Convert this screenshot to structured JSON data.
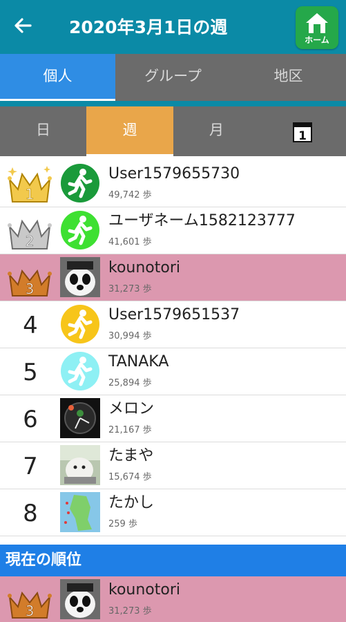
{
  "header": {
    "title": "2020年3月1日の週",
    "back_icon": "arrow-left-icon",
    "home_label": "ホーム",
    "color": "#0b8aa6"
  },
  "tabs_scope": [
    {
      "label": "個人",
      "active": true
    },
    {
      "label": "グループ",
      "active": false
    },
    {
      "label": "地区",
      "active": false
    }
  ],
  "tabs_period": [
    {
      "label": "日",
      "active": false
    },
    {
      "label": "週",
      "active": true
    },
    {
      "label": "月",
      "active": false
    },
    {
      "label": "1",
      "icon": "calendar-icon",
      "active": false
    }
  ],
  "ranking": [
    {
      "rank": "1",
      "badge": "gold-crown",
      "name": "User1579655730",
      "steps": "49,742 歩",
      "avatar": "walker-green-dark"
    },
    {
      "rank": "2",
      "badge": "silver-crown",
      "name": "ユーザネーム1582123777",
      "steps": "41,601 歩",
      "avatar": "walker-green-light"
    },
    {
      "rank": "3",
      "badge": "bronze-crown",
      "name": "kounotori",
      "steps": "31,273 歩",
      "avatar": "panda-photo",
      "me": true
    },
    {
      "rank": "4",
      "name": "User1579651537",
      "steps": "30,994 歩",
      "avatar": "walker-yellow"
    },
    {
      "rank": "5",
      "name": "TANAKA",
      "steps": "25,894 歩",
      "avatar": "walker-cyan"
    },
    {
      "rank": "6",
      "name": "メロン",
      "steps": "21,167 歩",
      "avatar": "watch-photo"
    },
    {
      "rank": "7",
      "name": "たまや",
      "steps": "15,674 歩",
      "avatar": "mascot-photo"
    },
    {
      "rank": "8",
      "name": "たかし",
      "steps": "259 歩",
      "avatar": "map-photo"
    }
  ],
  "current": {
    "heading": "現在の順位",
    "rank": "3",
    "name": "kounotori",
    "steps": "31,273 歩"
  }
}
